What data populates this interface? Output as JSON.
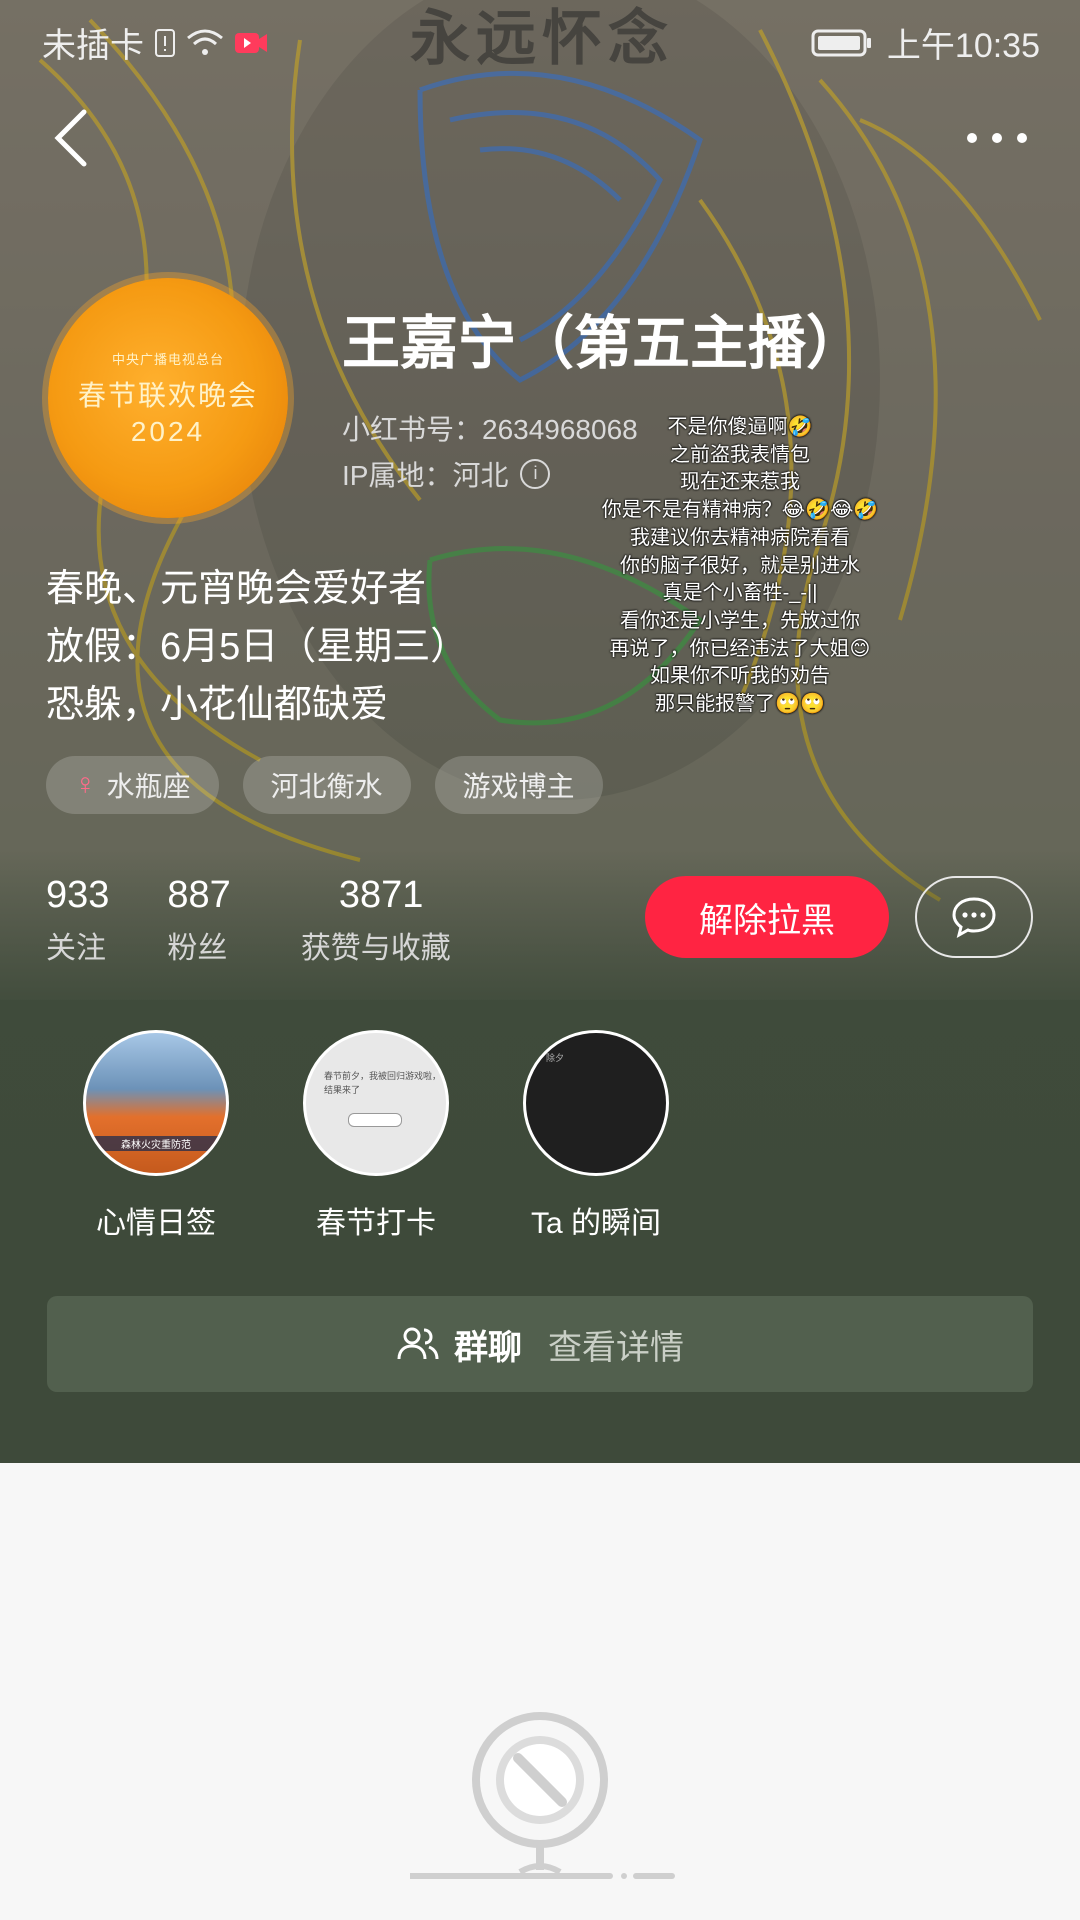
{
  "status_bar": {
    "carrier": "未插卡",
    "time": "上午10:35",
    "background_title": "永远怀念"
  },
  "header": {
    "back_icon": "chevron-left-icon",
    "more_icon": "more-dots-icon"
  },
  "profile": {
    "avatar_line1": "中央广播电视总台",
    "avatar_line2": "春节联欢晚会",
    "avatar_line3": "2024",
    "name": "王嘉宁（第五主播）",
    "id_label": "小红书号：2634968068",
    "ip_label": "IP属地：河北",
    "overlay_lines": [
      "不是你傻逼啊🤣",
      "之前盗我表情包",
      "现在还来惹我",
      "你是不是有精神病？😂🤣😂🤣",
      "我建议你去精神病院看看",
      "你的脑子很好，就是别进水",
      "真是个小畜牲-_-||",
      "看你还是小学生，先放过你",
      "再说了，你已经违法了大姐😊",
      "如果你不听我的劝告",
      "那只能报警了🙄🙄"
    ],
    "bio_lines": [
      "春晚、元宵晚会爱好者",
      "放假：6月5日（星期三）",
      "恐躲，小花仙都缺爱"
    ],
    "tags": [
      {
        "icon": "venus-icon",
        "label": "水瓶座"
      },
      {
        "label": "河北衡水"
      },
      {
        "label": "游戏博主"
      }
    ]
  },
  "stats": [
    {
      "num": "933",
      "label": "关注"
    },
    {
      "num": "887",
      "label": "粉丝"
    },
    {
      "num": "3871",
      "label": "获赞与收藏"
    }
  ],
  "actions": {
    "unblock_label": "解除拉黑",
    "message_icon": "chat-bubble-icon"
  },
  "moments": [
    {
      "label": "心情日签",
      "thumb_caption": "森林火灾重防范"
    },
    {
      "label": "春节打卡",
      "thumb_text1": "春节前夕，我被回归游戏啦，",
      "thumb_text2": "结果来了"
    },
    {
      "label": "Ta 的瞬间",
      "thumb_text": "除夕"
    }
  ],
  "group_chat": {
    "icon": "group-users-icon",
    "title": "群聊",
    "detail": "查看详情"
  },
  "empty_state": {
    "icon": "blocked-content-icon"
  },
  "colors": {
    "accent": "#ff2442",
    "hero_bottom": "#3e4a3a",
    "group_bg": "#52604e"
  }
}
